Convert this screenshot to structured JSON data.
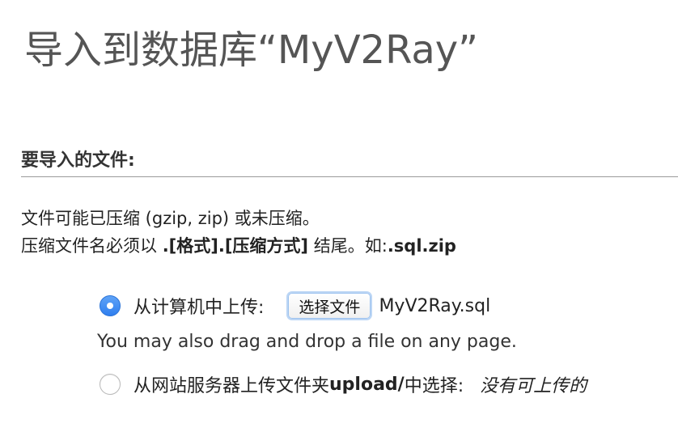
{
  "page": {
    "title": "导入到数据库“MyV2Ray”"
  },
  "section": {
    "heading": "要导入的文件:"
  },
  "description": {
    "line1": "文件可能已压缩 (gzip, zip) 或未压缩。",
    "line2_prefix": "压缩文件名必须以 ",
    "line2_format": ".[格式].[压缩方式]",
    "line2_middle": " 结尾。如:",
    "line2_example": ".sql.zip"
  },
  "upload_options": {
    "computer": {
      "label": "从计算机中上传:",
      "selected": true,
      "button_label": "选择文件",
      "file_name": "MyV2Ray.sql"
    },
    "drag_hint": "You may also drag and drop a file on any page.",
    "server": {
      "label_prefix": "从网站服务器上传文件夹 ",
      "folder": "upload/",
      "label_suffix": " 中选择:",
      "status": "没有可上传的",
      "selected": false
    }
  },
  "colors": {
    "radio_selected": "#2f7fef",
    "button_focus_ring": "#bcd6f5"
  }
}
